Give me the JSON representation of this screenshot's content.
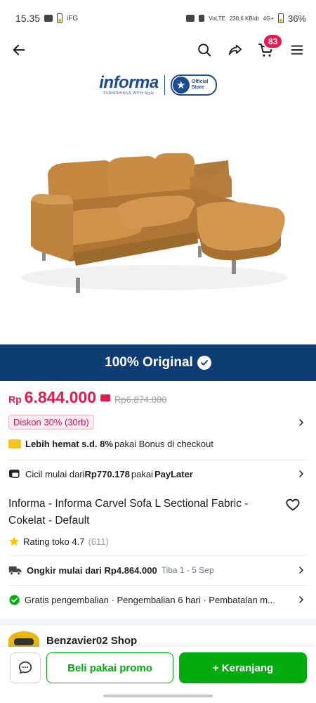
{
  "status_bar": {
    "time": "15.35",
    "extra_left": "iFG",
    "net_label": "VoLTE",
    "speed": "238,6 KB/dt",
    "signal_label": "4G+",
    "battery": "36%"
  },
  "nav": {
    "cart_count": "83"
  },
  "brand": {
    "name": "informa",
    "tagline": "FURNISHINGS WITH Style",
    "official_label": "Official Store"
  },
  "banner": {
    "text": "100% Original"
  },
  "price": {
    "currency": "Rp",
    "current": "6.844.000",
    "original": "Rp6.874.000",
    "discount": "Diskon 30% (30rb)"
  },
  "bonus": {
    "bold": "Lebih hemat s.d. 8%",
    "rest": " pakai Bonus di checkout"
  },
  "paylater": {
    "prefix": "Cicil mulai dari ",
    "amount": "Rp770.178",
    "mid": " pakai ",
    "provider": "PayLater"
  },
  "product": {
    "title": "Informa - Informa Carvel Sofa L Sectional Fabric - Cokelat - Default"
  },
  "rating": {
    "label": "Rating toko 4.7",
    "count": "(611)"
  },
  "shipping": {
    "bold": "Ongkir mulai dari Rp4.864.000",
    "eta": "Tiba 1 - 5 Sep"
  },
  "returns": {
    "text": "Gratis pengembalian · Pengembalian 6 hari · Pembatalan m..."
  },
  "shop": {
    "name": "Benzavier02 Shop"
  },
  "actions": {
    "promo": "Beli pakai promo",
    "cart": "+ Keranjang"
  },
  "colors": {
    "brand_blue": "#0d3d73",
    "price_red": "#e8194c",
    "green": "#03ac0e"
  },
  "icons": [
    "back-arrow-icon",
    "search-icon",
    "share-icon",
    "cart-icon",
    "menu-icon",
    "chevron-right-icon",
    "heart-icon",
    "star-icon",
    "truck-icon",
    "shield-check-icon",
    "chat-icon",
    "paylater-icon"
  ]
}
